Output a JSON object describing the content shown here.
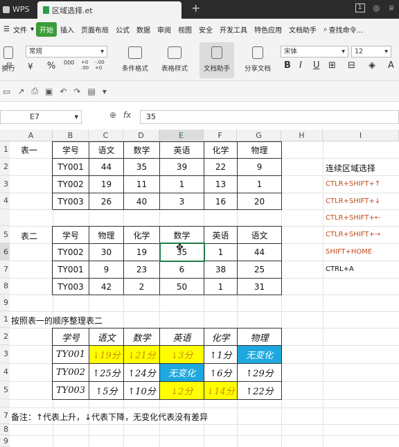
{
  "titlebar": {
    "app_name": "WPS",
    "file_tab": "区域选择.et",
    "new_tab": "+",
    "badge": "1"
  },
  "menu": {
    "file_label": "文件",
    "items": [
      "开始",
      "插入",
      "页面布局",
      "公式",
      "数据",
      "审阅",
      "视图",
      "安全",
      "开发工具",
      "特色应用",
      "文档助手"
    ],
    "search_label": "查找命令..."
  },
  "ribbon": {
    "wrap_label": "换行",
    "number_format": "常规",
    "currency": "¥",
    "percent": "%",
    "thousands": "000",
    "dec_inc": "+0 .00",
    "dec_dec": "-.00 +0",
    "cond_format": "条件格式",
    "table_style": "表格样式",
    "doc_assist": "文档助手",
    "share_doc": "分享文档",
    "font_name": "宋体",
    "font_size": "12",
    "bold": "B",
    "italic": "I",
    "underline": "U"
  },
  "formula_bar": {
    "cell_ref": "E7",
    "fx": "fx",
    "value": "35"
  },
  "columns": [
    "A",
    "B",
    "C",
    "D",
    "E",
    "F",
    "G",
    "H",
    "I"
  ],
  "rows": [
    "1",
    "2",
    "3",
    "4",
    "5",
    "6",
    "7",
    "8",
    "9",
    "",
    "1",
    "2",
    "3",
    "4",
    "5",
    "",
    "7",
    "8",
    "9"
  ],
  "table1": {
    "label": "表一",
    "header": [
      "学号",
      "语文",
      "数学",
      "英语",
      "化学",
      "物理"
    ],
    "rows": [
      [
        "TY001",
        "44",
        "35",
        "39",
        "22",
        "9"
      ],
      [
        "TY002",
        "19",
        "11",
        "1",
        "13",
        "1"
      ],
      [
        "TY003",
        "26",
        "40",
        "3",
        "16",
        "20"
      ]
    ]
  },
  "table2": {
    "label": "表二",
    "header": [
      "学号",
      "物理",
      "化学",
      "数学",
      "英语",
      "语文"
    ],
    "rows": [
      [
        "TY002",
        "30",
        "19",
        "35",
        "1",
        "44"
      ],
      [
        "TY001",
        "9",
        "23",
        "6",
        "38",
        "25"
      ],
      [
        "TY003",
        "42",
        "2",
        "50",
        "1",
        "31"
      ]
    ]
  },
  "shortcuts": {
    "title": "连续区域选择",
    "items": [
      "CTLR+SHIFT+↑",
      "CTLR+SHIFT+↓",
      "CTLR+SHIFT+←",
      "CTLR+SHIFT+→",
      "SHIFT+HOME"
    ],
    "ctrl_a": "CTRL+A"
  },
  "table3": {
    "title": "按照表一的顺序整理表二",
    "header": [
      "学号",
      "语文",
      "数学",
      "英语",
      "化学",
      "物理"
    ],
    "rows": [
      [
        "TY001",
        "↓19分",
        "↓21分",
        "↓3分",
        "↑1分",
        "无变化"
      ],
      [
        "TY002",
        "↑25分",
        "↑24分",
        "无变化",
        "↑6分",
        "↑29分"
      ],
      [
        "TY003",
        "↑5分",
        "↑10分",
        "↓2分",
        "↓14分",
        "↑22分"
      ]
    ],
    "yellow": "#ffff00",
    "blue": "#1fa8e0"
  },
  "note": "备注：↑代表上升，↓代表下降，无变化代表没有差异"
}
